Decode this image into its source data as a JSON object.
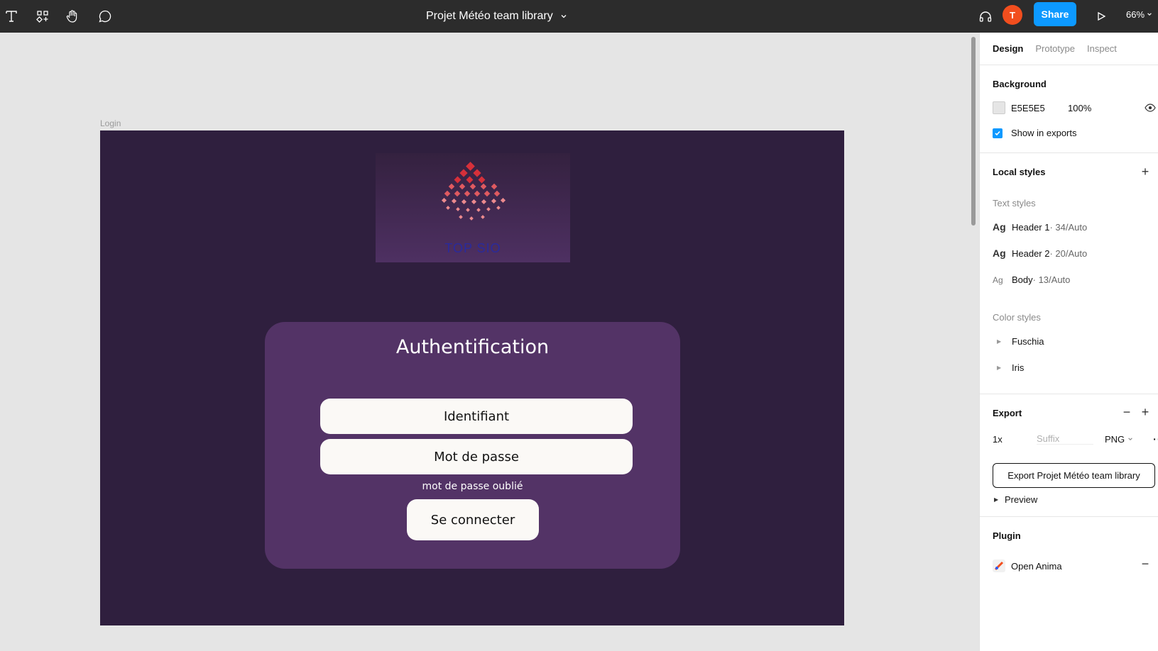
{
  "toolbar": {
    "file_title": "Projet Météo team library",
    "avatar_initial": "T",
    "share_label": "Share",
    "zoom": "66%"
  },
  "canvas": {
    "frame_label": "Login",
    "logo_text": "TOP SIO",
    "card_title": "Authentification",
    "username_field": "Identifiant",
    "password_field": "Mot de passe",
    "forgot_link": "mot de passe oublié",
    "connect_button": "Se connecter"
  },
  "panel": {
    "tabs": [
      "Design",
      "Prototype",
      "Inspect"
    ],
    "background": {
      "title": "Background",
      "hex": "E5E5E5",
      "opacity": "100%",
      "show_in_exports": "Show in exports",
      "swatch_color": "#e5e5e5"
    },
    "local_styles": {
      "title": "Local styles",
      "text_styles_title": "Text styles",
      "text_styles": [
        {
          "sample": "Ag",
          "name": "Header 1",
          "meta": " · 34/Auto"
        },
        {
          "sample": "Ag",
          "name": "Header 2",
          "meta": " · 20/Auto"
        },
        {
          "sample": "Ag",
          "name": "Body",
          "meta": " · 13/Auto"
        }
      ],
      "color_styles_title": "Color styles",
      "color_styles": [
        "Fuschia",
        "Iris"
      ]
    },
    "export": {
      "title": "Export",
      "scale": "1x",
      "suffix_placeholder": "Suffix",
      "format": "PNG",
      "button_label": "Export Projet Météo team library",
      "preview_label": "Preview"
    },
    "plugin": {
      "title": "Plugin",
      "name": "Open Anima"
    }
  },
  "colors": {
    "toolbar_bg": "#2c2c2c",
    "share_blue": "#0d99ff",
    "frame_bg": "#2f1f3e",
    "card_bg": "#533366",
    "avatar": "#f24e1e"
  }
}
